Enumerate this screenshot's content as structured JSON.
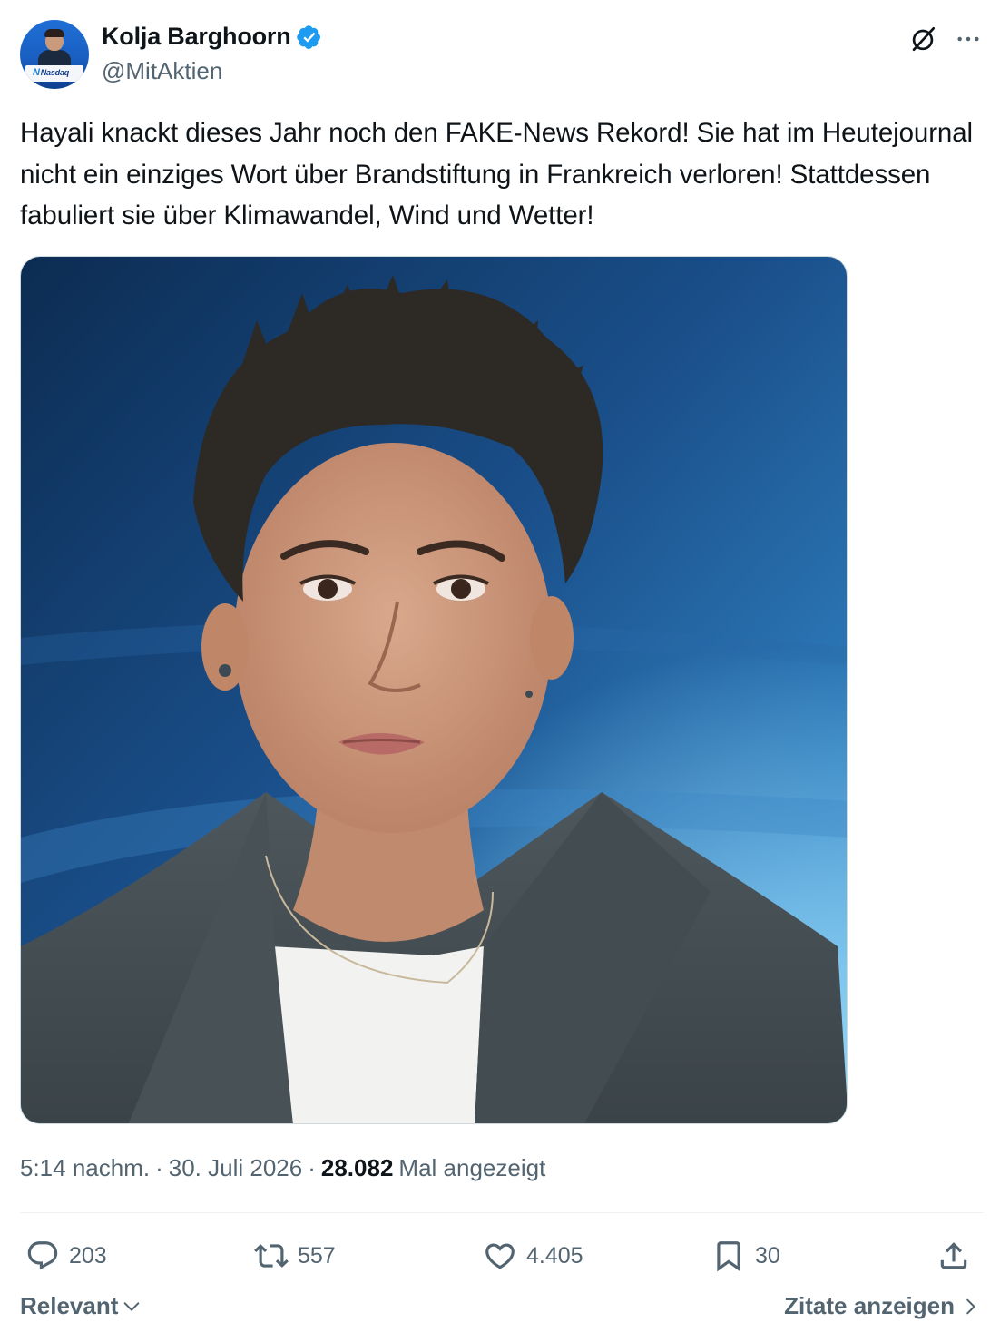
{
  "author": {
    "display_name": "Kolja Barghoorn",
    "handle": "@MitAktien",
    "verified": true,
    "avatar_logo_text": "Nasdaq"
  },
  "tweet": {
    "text": "Hayali knackt dieses Jahr noch den FAKE-News Rekord! Sie hat im Heutejournal nicht ein einziges Wort über Brandstiftung in Frankreich verloren! Stattdessen fabuliert sie über Klimawandel, Wind und Wetter!"
  },
  "meta": {
    "time": "5:14 nachm.",
    "sep1": "·",
    "date": "30. Juli 2026",
    "sep2": "·",
    "views_count": "28.082",
    "views_label": "Mal angezeigt"
  },
  "actions": {
    "replies": "203",
    "reposts": "557",
    "likes": "4.405",
    "bookmarks": "30"
  },
  "footer": {
    "sort_label": "Relevant",
    "quotes_label": "Zitate anzeigen"
  },
  "colors": {
    "text_primary": "#0f1419",
    "text_secondary": "#536471",
    "verified_blue": "#1d9bf0",
    "divider": "#eff3f4"
  },
  "icons": {
    "verified": "verified-badge-icon",
    "grok": "grok-icon",
    "more": "more-icon",
    "reply": "reply-icon",
    "repost": "repost-icon",
    "like": "heart-icon",
    "bookmark": "bookmark-icon",
    "share": "share-icon"
  }
}
